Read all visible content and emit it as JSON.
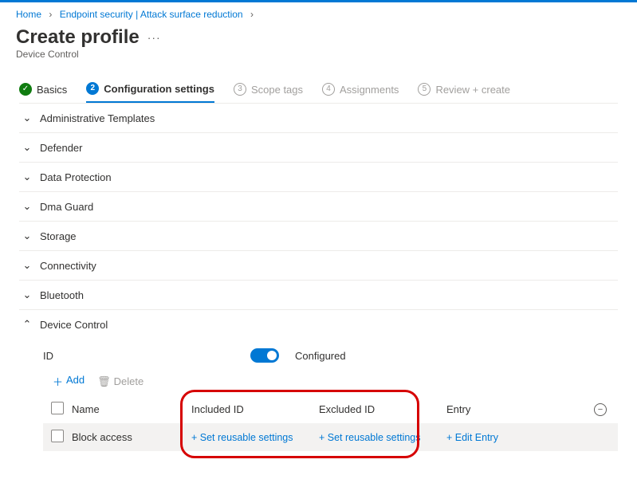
{
  "breadcrumb": {
    "home": "Home",
    "item2": "Endpoint security | Attack surface reduction"
  },
  "page": {
    "title": "Create profile",
    "subtitle": "Device Control",
    "more": "···"
  },
  "tabs": {
    "t1": {
      "num": "✓",
      "label": "Basics"
    },
    "t2": {
      "num": "2",
      "label": "Configuration settings"
    },
    "t3": {
      "num": "3",
      "label": "Scope tags"
    },
    "t4": {
      "num": "4",
      "label": "Assignments"
    },
    "t5": {
      "num": "5",
      "label": "Review + create"
    }
  },
  "sections": {
    "s1": "Administrative Templates",
    "s2": "Defender",
    "s3": "Data Protection",
    "s4": "Dma Guard",
    "s5": "Storage",
    "s6": "Connectivity",
    "s7": "Bluetooth",
    "s8": "Device Control"
  },
  "device_control": {
    "id_label": "ID",
    "toggle_label": "Configured",
    "add_label": "Add",
    "delete_label": "Delete",
    "columns": {
      "name": "Name",
      "included": "Included ID",
      "excluded": "Excluded ID",
      "entry": "Entry"
    },
    "row": {
      "name": "Block access",
      "inc_action": "+ Set reusable settings",
      "exc_action": "+ Set reusable settings",
      "entry_action": "+ Edit Entry"
    }
  }
}
